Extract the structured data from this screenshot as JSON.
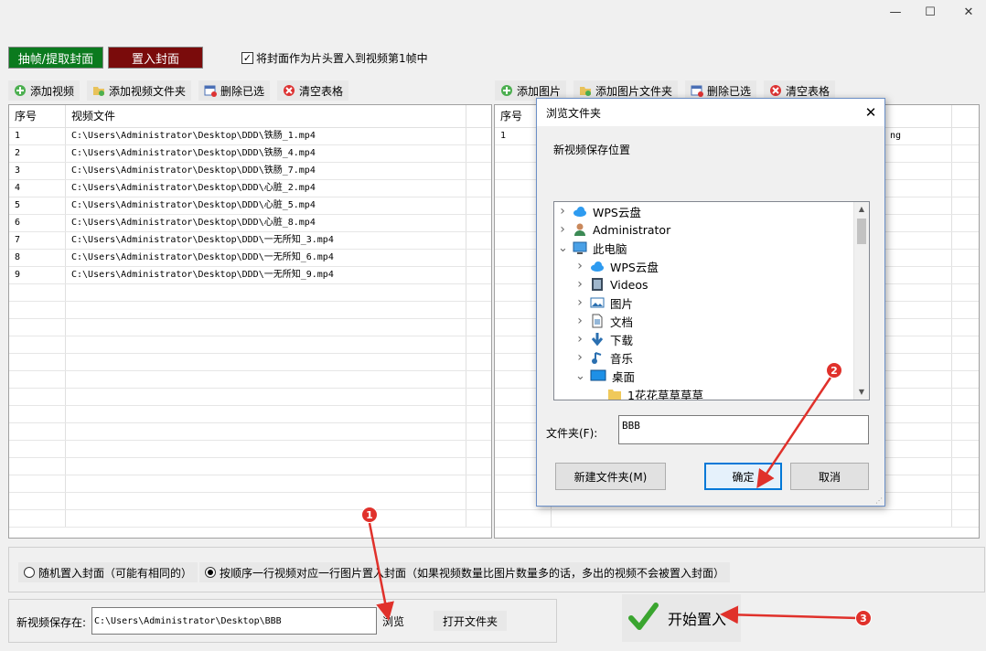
{
  "window": {
    "min_icon": "minimize-icon",
    "max_icon": "maximize-icon",
    "close_icon": "close-icon"
  },
  "top_buttons": {
    "extract": "抽帧/提取封面",
    "embed": "置入封面",
    "extract_color": "#0b7a1e",
    "embed_color": "#7a0b0b"
  },
  "first_frame_checkbox": {
    "label": "将封面作为片头置入到视频第1帧中",
    "checked": true
  },
  "left_toolbar": {
    "add_video": "添加视频",
    "add_video_folder": "添加视频文件夹",
    "delete_selected": "删除已选",
    "clear_table": "清空表格"
  },
  "right_toolbar": {
    "add_image": "添加图片",
    "add_image_folder": "添加图片文件夹",
    "delete_selected": "删除已选",
    "clear_table": "清空表格"
  },
  "video_table": {
    "headers": [
      "序号",
      "视频文件"
    ],
    "rows": [
      [
        "1",
        "C:\\Users\\Administrator\\Desktop\\DDD\\铁肠_1.mp4"
      ],
      [
        "2",
        "C:\\Users\\Administrator\\Desktop\\DDD\\铁肠_4.mp4"
      ],
      [
        "3",
        "C:\\Users\\Administrator\\Desktop\\DDD\\铁肠_7.mp4"
      ],
      [
        "4",
        "C:\\Users\\Administrator\\Desktop\\DDD\\心脏_2.mp4"
      ],
      [
        "5",
        "C:\\Users\\Administrator\\Desktop\\DDD\\心脏_5.mp4"
      ],
      [
        "6",
        "C:\\Users\\Administrator\\Desktop\\DDD\\心脏_8.mp4"
      ],
      [
        "7",
        "C:\\Users\\Administrator\\Desktop\\DDD\\一无所知_3.mp4"
      ],
      [
        "8",
        "C:\\Users\\Administrator\\Desktop\\DDD\\一无所知_6.mp4"
      ],
      [
        "9",
        "C:\\Users\\Administrator\\Desktop\\DDD\\一无所知_9.mp4"
      ]
    ]
  },
  "image_table": {
    "headers": [
      "序号"
    ],
    "rows": [
      [
        "1",
        "ng"
      ]
    ]
  },
  "mode": {
    "random": "随机置入封面（可能有相同的）",
    "sequential": "按顺序一行视频对应一行图片置入封面（如果视频数量比图片数量多的话，多出的视频不会被置入封面）",
    "selected": "sequential"
  },
  "save": {
    "label": "新视频保存在:",
    "path": "C:\\Users\\Administrator\\Desktop\\BBB",
    "browse": "浏览",
    "open_folder": "打开文件夹"
  },
  "start_button": {
    "label": "开始置入"
  },
  "dialog": {
    "title": "浏览文件夹",
    "prompt": "新视频保存位置",
    "tree": [
      {
        "label": "WPS云盘",
        "level": 0,
        "expanded": false,
        "icon": "cloud-icon"
      },
      {
        "label": "Administrator",
        "level": 0,
        "expanded": false,
        "icon": "user-icon"
      },
      {
        "label": "此电脑",
        "level": 0,
        "expanded": true,
        "icon": "computer-icon"
      },
      {
        "label": "WPS云盘",
        "level": 1,
        "expanded": false,
        "icon": "cloud-icon"
      },
      {
        "label": "Videos",
        "level": 1,
        "expanded": false,
        "icon": "video-icon"
      },
      {
        "label": "图片",
        "level": 1,
        "expanded": false,
        "icon": "pictures-icon"
      },
      {
        "label": "文档",
        "level": 1,
        "expanded": false,
        "icon": "document-icon"
      },
      {
        "label": "下载",
        "level": 1,
        "expanded": false,
        "icon": "download-icon"
      },
      {
        "label": "音乐",
        "level": 1,
        "expanded": false,
        "icon": "music-icon"
      },
      {
        "label": "桌面",
        "level": 1,
        "expanded": true,
        "icon": "desktop-icon"
      },
      {
        "label": "1花花草草草草",
        "level": 2,
        "expanded": false,
        "icon": "folder-icon"
      }
    ],
    "folder_label": "文件夹(F):",
    "folder_value": "BBB",
    "new_folder": "新建文件夹(M)",
    "ok": "确定",
    "cancel": "取消"
  },
  "annotations": [
    "1",
    "2",
    "3"
  ],
  "colors": {
    "annotation_red": "#e0312b",
    "start_check_green": "#3aa52f"
  }
}
